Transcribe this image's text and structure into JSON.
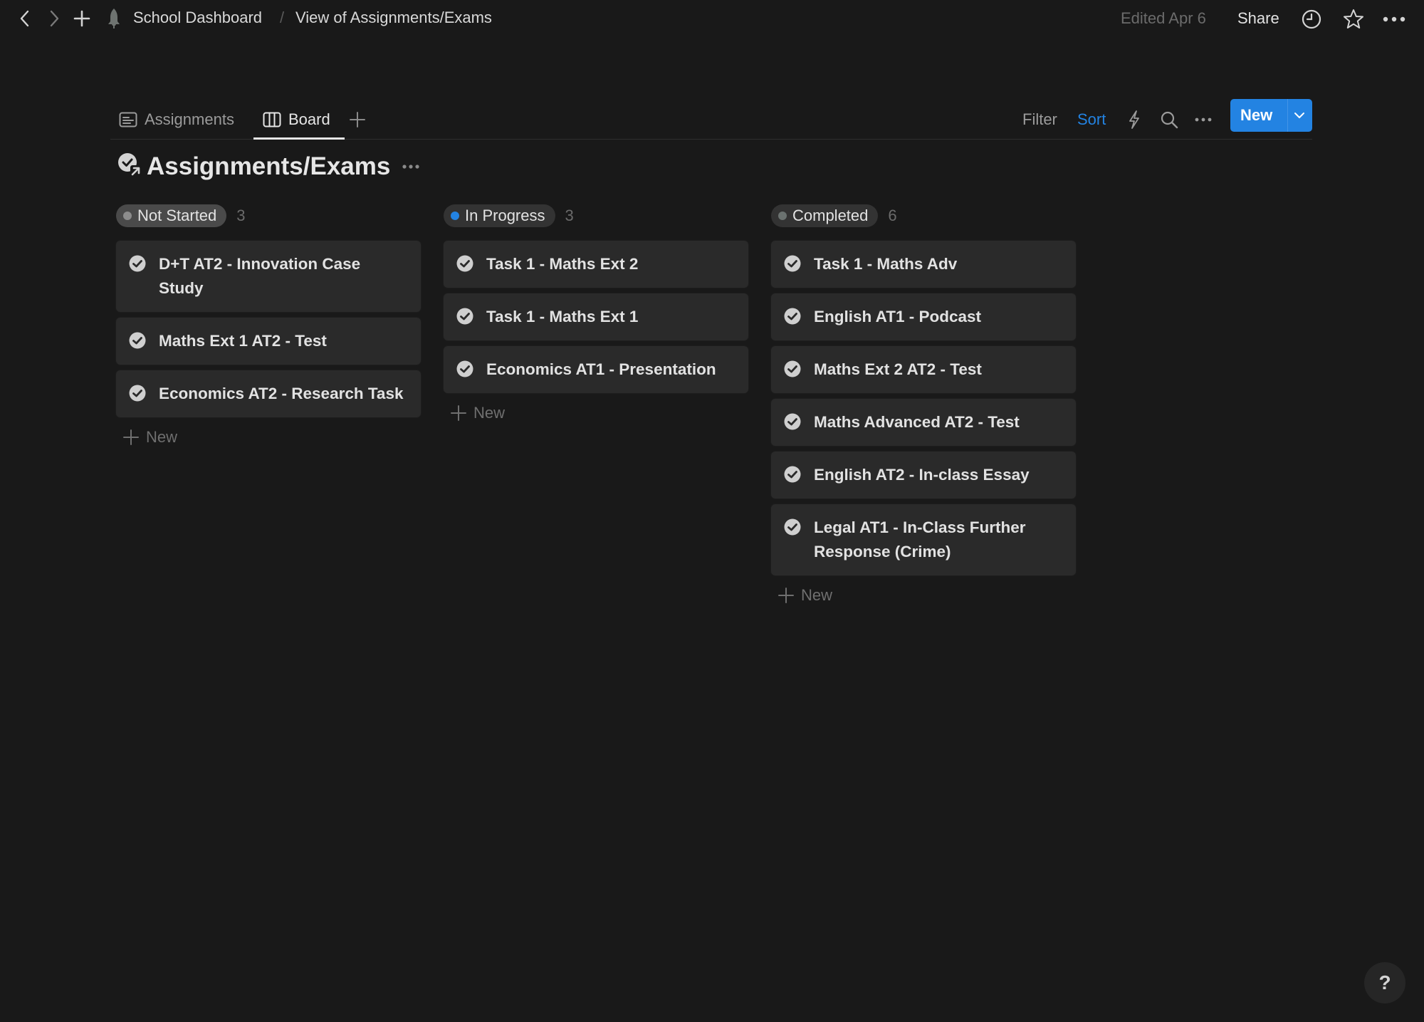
{
  "topbar": {
    "breadcrumb": [
      "School Dashboard",
      "View of Assignments/Exams"
    ],
    "separator": "/",
    "edited": "Edited Apr 6",
    "share_label": "Share",
    "icons": [
      "back-icon",
      "forward-icon",
      "plus-icon",
      "rocket-icon",
      "clock-icon",
      "star-icon",
      "more-icon"
    ]
  },
  "views": {
    "tabs": [
      {
        "label": "Assignments",
        "icon": "list-icon",
        "active": false
      },
      {
        "label": "Board",
        "icon": "board-icon",
        "active": true
      }
    ],
    "add_view_icon": "plus-icon"
  },
  "toolbar": {
    "filter_label": "Filter",
    "sort_label": "Sort",
    "new_label": "New",
    "accent": "#2383e2"
  },
  "database": {
    "title": "Assignments/Exams",
    "icon": "linked-check-icon"
  },
  "board": {
    "add_label": "New",
    "columns": [
      {
        "status": "Not Started",
        "count": "3",
        "dot_color": "#8c8c8c",
        "pill_color": "#4a4a4a",
        "cards": [
          "D+T AT2 - Innovation Case Study",
          "Maths Ext 1 AT2 - Test",
          "Economics AT2 - Research Task"
        ]
      },
      {
        "status": "In Progress",
        "count": "3",
        "dot_color": "#2383e2",
        "pill_color": "#333333",
        "cards": [
          "Task 1 - Maths Ext 2",
          "Task 1 - Maths Ext 1",
          "Economics AT1 - Presentation"
        ]
      },
      {
        "status": "Completed",
        "count": "6",
        "dot_color": "#6b7270",
        "pill_color": "#333333",
        "cards": [
          "Task 1 - Maths Adv",
          "English AT1 - Podcast",
          "Maths Ext 2 AT2 - Test",
          "Maths Advanced AT2 - Test",
          "English AT2 - In-class Essay",
          "Legal AT1 - In-Class Further Response (Crime)"
        ]
      }
    ]
  },
  "help": {
    "label": "?"
  }
}
